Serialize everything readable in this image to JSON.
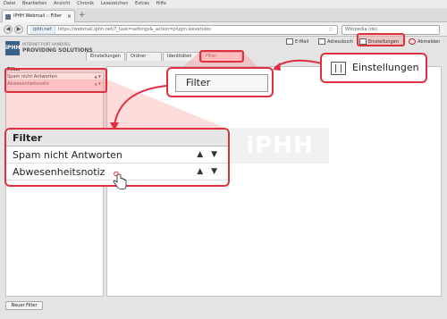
{
  "browser": {
    "menu": [
      "Datei",
      "Bearbeiten",
      "Ansicht",
      "Chronik",
      "Lesezeichen",
      "Extras",
      "Hilfe"
    ],
    "tab_title": "iPHH Webmail :: Filter",
    "new_tab": "+",
    "url_site": "iphh.net",
    "url": "https://webmail.iphh.net/?_task=settings&_action=plugin.sieverules",
    "search": "Wikipedia (de)"
  },
  "header": {
    "logo_mark": "iPHH",
    "logo_line1": "INTERNET PORT HAMBURG",
    "logo_line2": "PROVIDING SOLUTIONS",
    "nav": {
      "email": "E-Mail",
      "addressbook": "Adressbuch",
      "settings": "Einstellungen",
      "logout": "Abmelden"
    }
  },
  "tabs": [
    "Einstellungen",
    "Ordner",
    "Identitäten",
    "Filter"
  ],
  "filter_list": {
    "header": "Filter",
    "rows": [
      "Spam nicht Antworten",
      "Abwesenheitsnotiz"
    ]
  },
  "watermark": "iPHH",
  "new_filter_button": "Neuer Filter",
  "callouts": {
    "settings_label": "Einstellungen",
    "filter_tab_label": "Filter",
    "list_header": "Filter",
    "list_rows": [
      "Spam nicht Antworten",
      "Abwesenheitsnotiz"
    ],
    "arrows": "▲ ▼"
  },
  "colors": {
    "highlight": "#e03040",
    "logo": "#3c5f86"
  }
}
